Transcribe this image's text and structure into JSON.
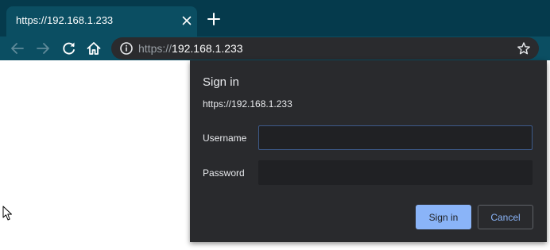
{
  "tab": {
    "title": "https://192.168.1.233"
  },
  "toolbar": {
    "url_scheme": "https://",
    "url_host": "192.168.1.233"
  },
  "dialog": {
    "title": "Sign in",
    "origin": "https://192.168.1.233",
    "username_label": "Username",
    "password_label": "Password",
    "username_value": "",
    "password_value": "",
    "signin_label": "Sign in",
    "cancel_label": "Cancel"
  },
  "colors": {
    "tabstrip": "#053a4c",
    "toolbar": "#0b4e62",
    "omnibox": "#2a2b2e",
    "dialog_bg": "#292a2d",
    "field_bg": "#202124",
    "accent": "#8ab4f8"
  },
  "icons": [
    "close-icon",
    "plus-icon",
    "back-arrow-icon",
    "forward-arrow-icon",
    "reload-icon",
    "home-icon",
    "info-icon",
    "star-icon",
    "mouse-cursor-icon"
  ]
}
